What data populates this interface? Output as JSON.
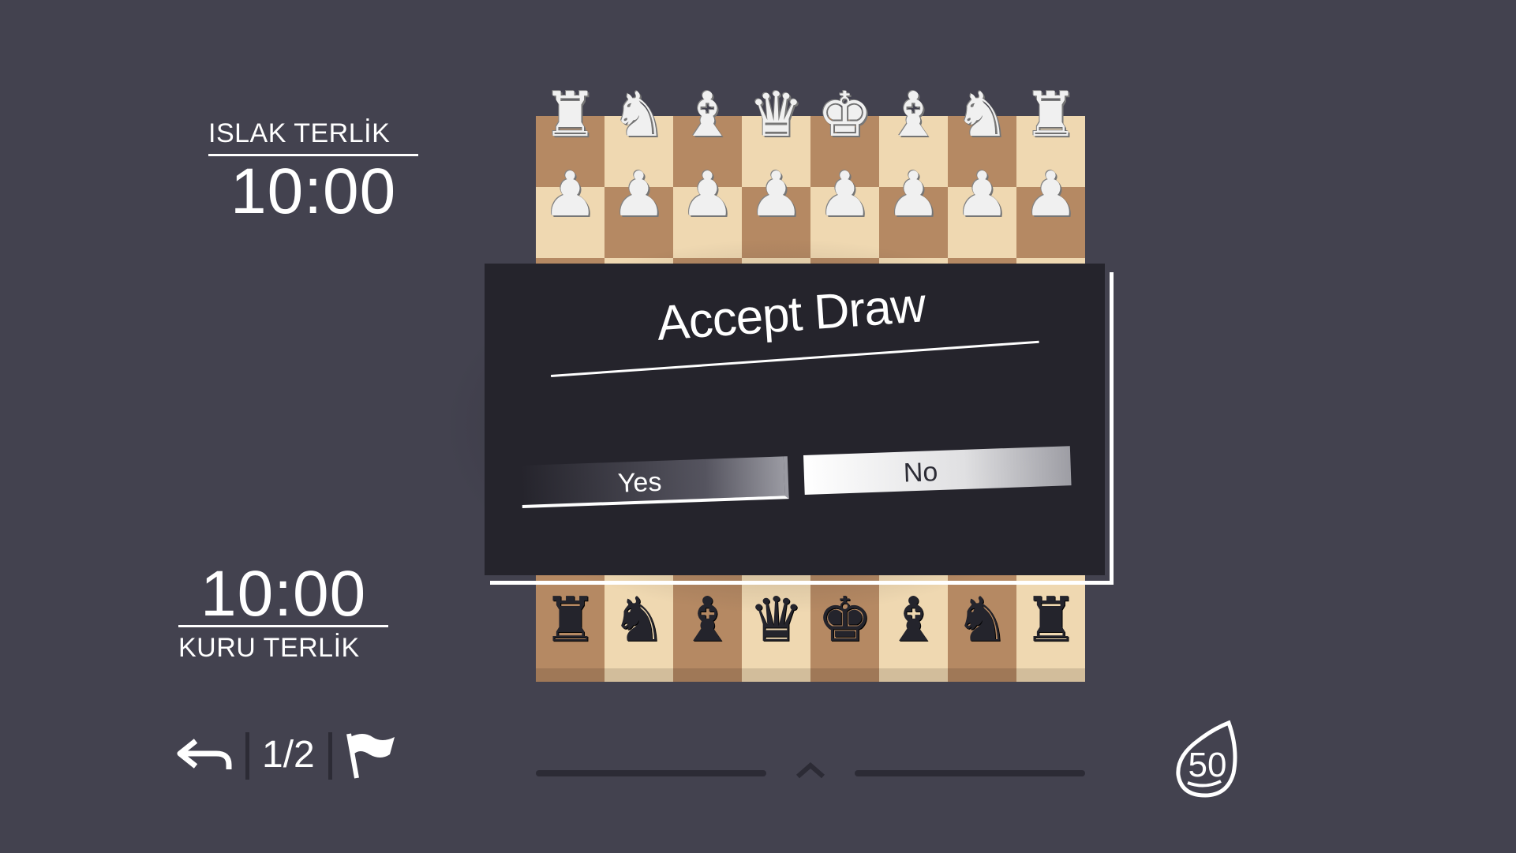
{
  "players": {
    "top": {
      "name": "ISLAK TERLİK",
      "clock": "10:00"
    },
    "bottom": {
      "name": "KURU TERLİK",
      "clock": "10:00"
    }
  },
  "board": {
    "top_back_rank": [
      "♜",
      "♞",
      "♝",
      "♛",
      "♚",
      "♝",
      "♞",
      "♜"
    ],
    "top_pawns": [
      "♟",
      "♟",
      "♟",
      "♟",
      "♟",
      "♟",
      "♟",
      "♟"
    ],
    "bottom_back_rank": [
      "♜",
      "♞",
      "♝",
      "♛",
      "♚",
      "♝",
      "♞",
      "♜"
    ],
    "colors": {
      "light": "#efd8b1",
      "dark": "#b58963",
      "white_piece": "#f0f0f0",
      "black_piece": "#24242c"
    }
  },
  "dialog": {
    "title": "Accept Draw",
    "yes_label": "Yes",
    "no_label": "No"
  },
  "controls": {
    "draw_offer_label": "1/2",
    "undo_icon": "undo-arrow-icon",
    "resign_icon": "flag-icon",
    "menu_icon": "chevron-up-icon",
    "seed_count": "50"
  },
  "theme": {
    "background": "#43424f",
    "panel": "#25242c",
    "accent": "#ffffff"
  }
}
